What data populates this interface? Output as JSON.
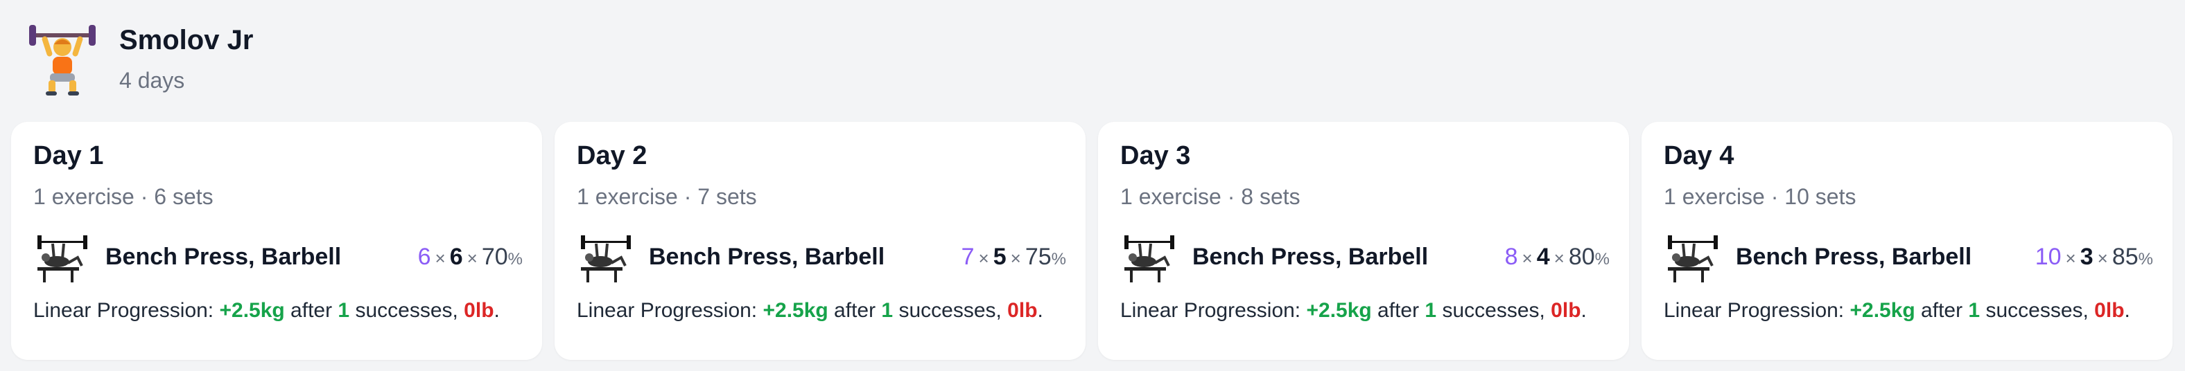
{
  "program": {
    "title": "Smolov Jr",
    "subtitle": "4 days",
    "icon": "weightlifter-icon"
  },
  "days": [
    {
      "title": "Day 1",
      "summary": "1 exercise · 6 sets",
      "exercise": {
        "name": "Bench Press, Barbell",
        "sets": "6",
        "reps": "6",
        "percent": "70",
        "percent_sign": "%"
      },
      "progression": {
        "prefix": "Linear Progression: ",
        "increment": "+2.5kg",
        "after": " after ",
        "successes": "1",
        "successes_label": " successes, ",
        "decrement": "0lb",
        "end": "."
      }
    },
    {
      "title": "Day 2",
      "summary": "1 exercise · 7 sets",
      "exercise": {
        "name": "Bench Press, Barbell",
        "sets": "7",
        "reps": "5",
        "percent": "75",
        "percent_sign": "%"
      },
      "progression": {
        "prefix": "Linear Progression: ",
        "increment": "+2.5kg",
        "after": " after ",
        "successes": "1",
        "successes_label": " successes, ",
        "decrement": "0lb",
        "end": "."
      }
    },
    {
      "title": "Day 3",
      "summary": "1 exercise · 8 sets",
      "exercise": {
        "name": "Bench Press, Barbell",
        "sets": "8",
        "reps": "4",
        "percent": "80",
        "percent_sign": "%"
      },
      "progression": {
        "prefix": "Linear Progression: ",
        "increment": "+2.5kg",
        "after": " after ",
        "successes": "1",
        "successes_label": " successes, ",
        "decrement": "0lb",
        "end": "."
      }
    },
    {
      "title": "Day 4",
      "summary": "1 exercise · 10 sets",
      "exercise": {
        "name": "Bench Press, Barbell",
        "sets": "10",
        "reps": "3",
        "percent": "85",
        "percent_sign": "%"
      },
      "progression": {
        "prefix": "Linear Progression: ",
        "increment": "+2.5kg",
        "after": " after ",
        "successes": "1",
        "successes_label": " successes, ",
        "decrement": "0lb",
        "end": "."
      }
    }
  ],
  "colors": {
    "sets_accent": "#8b5cf6",
    "increment": "#16a34a",
    "decrement": "#dc2626"
  }
}
